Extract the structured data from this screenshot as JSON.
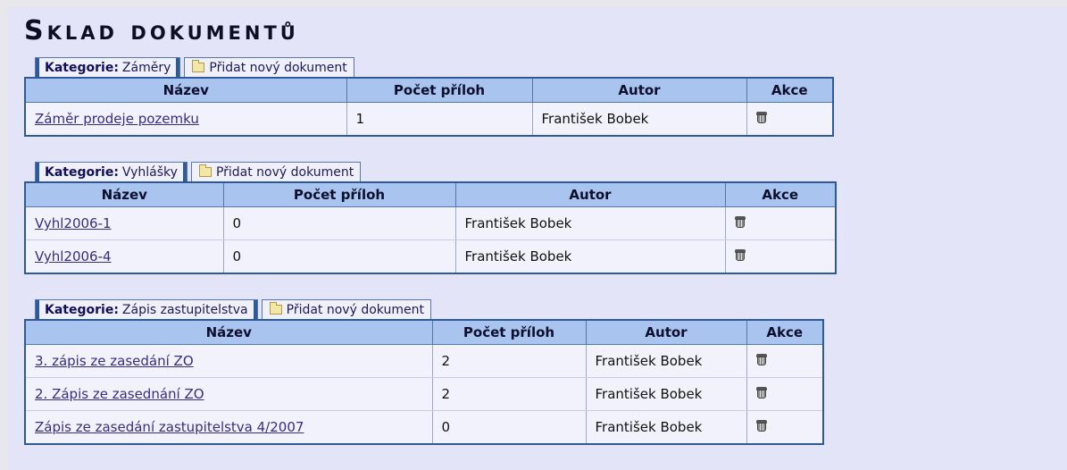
{
  "page_title": "Sklad dokumentů",
  "labels": {
    "category_prefix": "Kategorie:",
    "add_document": "Přidat nový dokument"
  },
  "columns": [
    "Název",
    "Počet příloh",
    "Autor",
    "Akce"
  ],
  "sections": [
    {
      "category": "Záměry",
      "rows": [
        {
          "name": "Záměr prodeje pozemku",
          "attachments": "1",
          "author": "František Bobek",
          "action_icon": "trash-icon"
        }
      ]
    },
    {
      "category": "Vyhlášky",
      "rows": [
        {
          "name": "Vyhl2006-1",
          "attachments": "0",
          "author": "František Bobek",
          "action_icon": "trash-icon"
        },
        {
          "name": "Vyhl2006-4",
          "attachments": "0",
          "author": "František Bobek",
          "action_icon": "trash-icon"
        }
      ]
    },
    {
      "category": "Zápis zastupitelstva",
      "rows": [
        {
          "name": "3. zápis ze zasedání ZO",
          "attachments": "2",
          "author": "František Bobek",
          "action_icon": "trash-icon"
        },
        {
          "name": "2. Zápis ze zasednání ZO",
          "attachments": "2",
          "author": "František Bobek",
          "action_icon": "trash-icon"
        },
        {
          "name": "Zápis ze zasedání zastupitelstva 4/2007",
          "attachments": "0",
          "author": "František Bobek",
          "action_icon": "trash-icon"
        }
      ]
    }
  ],
  "colors": {
    "background": "#e4e4f8",
    "header_bg": "#a9c4ee",
    "border": "#2e5a9c",
    "link": "#3a2b86"
  }
}
